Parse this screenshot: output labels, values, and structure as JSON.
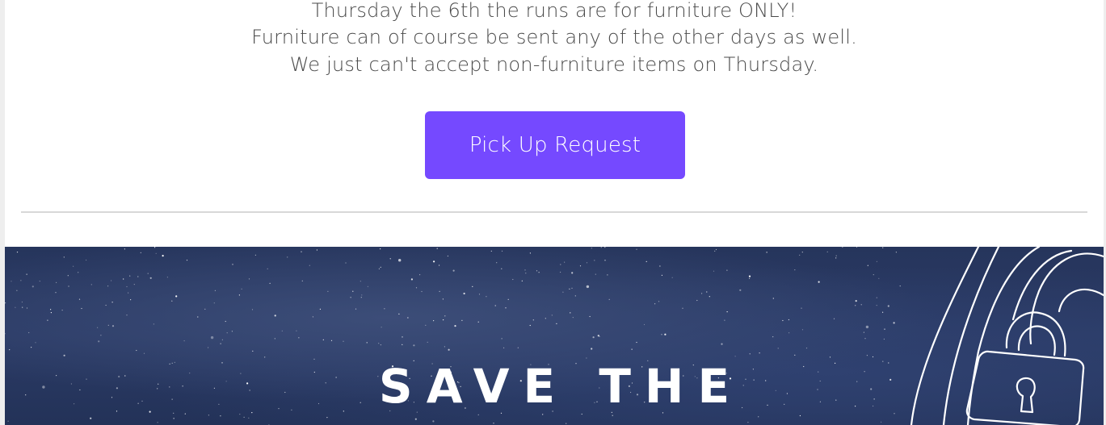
{
  "notice": {
    "line1": "Thursday the 6th the runs are for furniture ONLY!",
    "line2": "Furniture can of course be sent any of the other days as well.",
    "line3": "We just can't accept non-furniture items on Thursday."
  },
  "cta": {
    "label": "Pick Up Request"
  },
  "banner": {
    "title": "SAVE THE",
    "icon": "padlock-icon"
  },
  "colors": {
    "button": "#7549ff",
    "banner_sky": "#2b3b66",
    "text": "#4a4a4a"
  }
}
